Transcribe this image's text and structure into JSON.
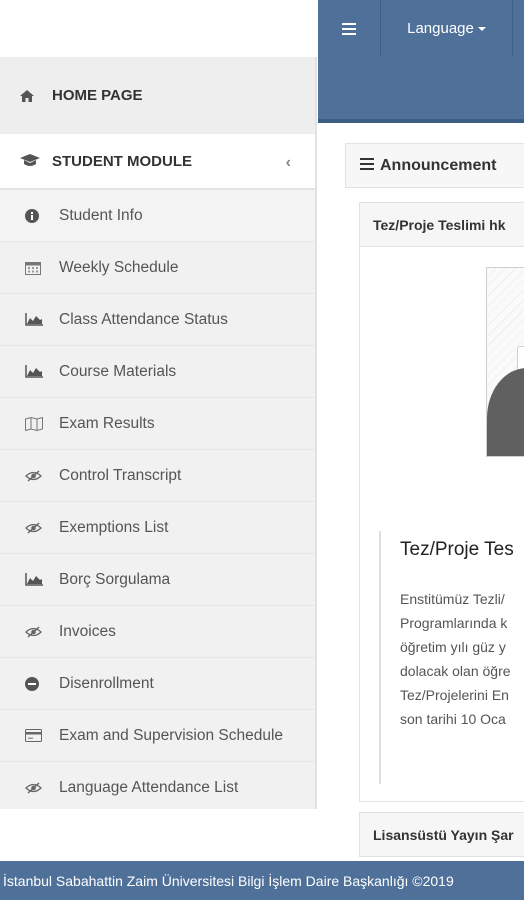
{
  "topbar": {
    "menu_icon": "hamburger-icon",
    "language_label": "Language"
  },
  "sidebar": {
    "home": {
      "icon": "home-icon",
      "label": "HOME PAGE"
    },
    "module": {
      "icon": "graduation-cap-icon",
      "label": "STUDENT MODULE",
      "chevron": "‹"
    },
    "items": [
      {
        "icon": "info-circle-icon",
        "label": "Student Info"
      },
      {
        "icon": "calendar-icon",
        "label": "Weekly Schedule"
      },
      {
        "icon": "area-chart-icon",
        "label": "Class Attendance Status"
      },
      {
        "icon": "area-chart-icon",
        "label": "Course Materials"
      },
      {
        "icon": "map-icon",
        "label": "Exam Results"
      },
      {
        "icon": "eye-slash-icon",
        "label": "Control Transcript"
      },
      {
        "icon": "eye-slash-icon",
        "label": "Exemptions List"
      },
      {
        "icon": "area-chart-icon",
        "label": "Borç Sorgulama"
      },
      {
        "icon": "eye-slash-icon",
        "label": "Invoices"
      },
      {
        "icon": "minus-circle-icon",
        "label": "Disenrollment"
      },
      {
        "icon": "credit-card-icon",
        "label": "Exam and Supervision Schedule"
      },
      {
        "icon": "eye-slash-icon",
        "label": "Language Attendance List"
      }
    ]
  },
  "main": {
    "announcement_header": "Announcement",
    "card_title": "Tez/Proje Teslimi hk",
    "news_title": "Tez/Proje Tes",
    "news_lines": [
      "Enstitümüz Tezli/",
      "Programlarında k",
      "öğretim yılı güz y",
      "dolacak olan öğre",
      "Tez/Projelerini En",
      "son tarihi 10 Oca"
    ],
    "second_card_title": "Lisansüstü Yayın Şar"
  },
  "footer": {
    "text": "İstanbul Sabahattin Zaim Üniversitesi Bilgi İşlem Daire Başkanlığı ©2019"
  },
  "colors": {
    "brand": "#4f7199",
    "sidebar_bg": "#f0f0f0"
  }
}
